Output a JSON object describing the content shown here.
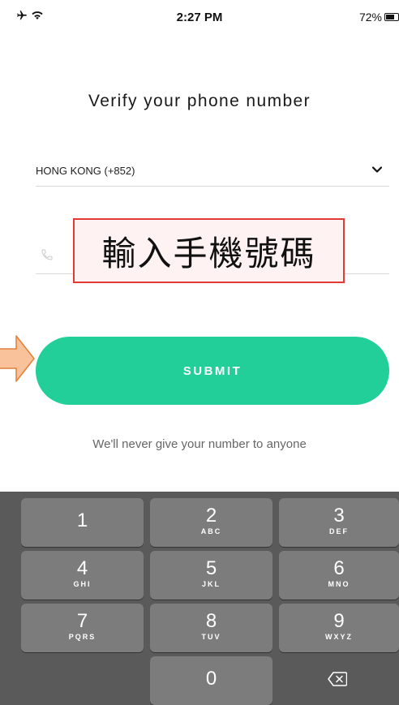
{
  "status_bar": {
    "time": "2:27 PM",
    "battery_percent": "72%",
    "battery_level": 0.72,
    "icons": [
      "airplane-icon",
      "wifi-icon",
      "battery-icon"
    ]
  },
  "title": "Verify your phone number",
  "country_select": {
    "value": "HONG KONG (+852)",
    "icon": "chevron-down-icon"
  },
  "phone_input": {
    "value": "",
    "placeholder": "",
    "icon": "phone-icon"
  },
  "annotation": {
    "label": "輸入手機號碼",
    "border_color": "#e53935",
    "arrow_color": "#f9c29a"
  },
  "submit_button": {
    "label": "SUBMIT",
    "color": "#22cf98"
  },
  "disclaimer": "We'll never give your number to anyone",
  "keypad": {
    "keys": [
      {
        "num": "1",
        "letters": ""
      },
      {
        "num": "2",
        "letters": "ABC"
      },
      {
        "num": "3",
        "letters": "DEF"
      },
      {
        "num": "4",
        "letters": "GHI"
      },
      {
        "num": "5",
        "letters": "JKL"
      },
      {
        "num": "6",
        "letters": "MNO"
      },
      {
        "num": "7",
        "letters": "PQRS"
      },
      {
        "num": "8",
        "letters": "TUV"
      },
      {
        "num": "9",
        "letters": "WXYZ"
      },
      {
        "num": "0",
        "letters": ""
      }
    ],
    "delete_icon": "backspace-icon"
  }
}
